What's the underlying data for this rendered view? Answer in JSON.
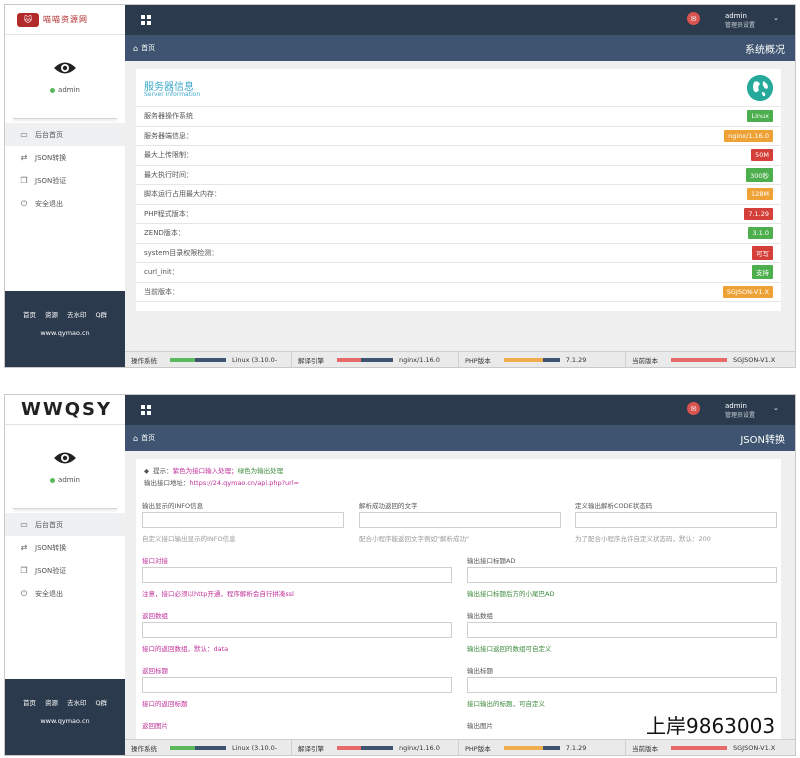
{
  "screen1": {
    "logo_text": "喵喵资源网",
    "user": "admin",
    "menu": [
      "后台首页",
      "JSON转换",
      "JSON验证",
      "安全退出"
    ],
    "footer_links": [
      "首页",
      "资源",
      "去水印",
      "Q群"
    ],
    "footer_domain": "www.qymao.cn",
    "top_admin": "admin",
    "top_role": "管理员设置",
    "breadcrumb": "首页",
    "page_title": "系统概况",
    "card_title": "服务器信息",
    "card_subtitle": "Server information",
    "info_rows": [
      {
        "label": "服务器操作系统",
        "value": "Linux"
      },
      {
        "label": "服务器端信息：",
        "value": "nginx/1.16.0"
      },
      {
        "label": "最大上传限制：",
        "value": "50M"
      },
      {
        "label": "最大执行时间：",
        "value": "300秒"
      },
      {
        "label": "脚本运行占用最大内存：",
        "value": "128M"
      },
      {
        "label": "PHP程式版本：",
        "value": "7.1.29"
      },
      {
        "label": "ZEND版本：",
        "value": "3.1.0"
      },
      {
        "label": "system目录权限检测：",
        "value": "可写"
      },
      {
        "label": "curl_init：",
        "value": "支持"
      },
      {
        "label": "当前版本：",
        "value": "SGJSON-V1.X"
      }
    ]
  },
  "status": [
    {
      "label": "操作系统",
      "value": "Linux (3.10.0-"
    },
    {
      "label": "解译引擎",
      "value": "nginx/1.16.0"
    },
    {
      "label": "PHP版本",
      "value": "7.1.29"
    },
    {
      "label": "当前版本",
      "value": "SGJSON-V1.X"
    }
  ],
  "screen2": {
    "logo_text": "WWQSY",
    "user": "admin",
    "menu": [
      "后台首页",
      "JSON转换",
      "JSON验证",
      "安全退出"
    ],
    "footer_links": [
      "首页",
      "资源",
      "去水印",
      "Q群"
    ],
    "footer_domain": "www.qymao.cn",
    "top_admin": "admin",
    "top_role": "管理员设置",
    "breadcrumb": "首页",
    "page_title": "JSON转换",
    "hint_prefix": "提示：",
    "hint_pink": "紫色为接口输入处理；",
    "hint_green": "绿色为输出处理",
    "api_prefix": "输出接口地址：",
    "api_url": "https://24.qymao.cn/api.php?url=",
    "fields": {
      "info_label": "输出显示的INFO信息",
      "info_help": "自定义接口输出显示的INFO信息",
      "parse_label": "解析成功返回的文字",
      "parse_help": "配合小程序能返回文字例如\"解析成功\"",
      "code_label": "定义输出解析CODE状态码",
      "code_help": "为了配合小程序允许自定义状态码，默认：200",
      "docking_label": "接口对接",
      "docking_help": "注意，接口必须以http开通，程序解析会自行拼凑ssl",
      "title_ad_label": "输出接口标题AD",
      "title_ad_help": "输出接口标题后方的小尾巴AD",
      "return_data_label": "返回数组",
      "return_data_help": "接口的返回数组，默认：data",
      "out_data_label": "输出数组",
      "out_data_help": "输出接口返回的数组可自定义",
      "return_title_label": "返回标题",
      "return_title_help": "接口的返回标题",
      "out_title_label": "输出标题",
      "out_title_help": "接口输出的标题，可自定义",
      "return_image_label": "返回图片",
      "out_image_label": "输出图片"
    }
  },
  "watermark": "上岸9863003",
  "colors": {
    "sidebar_footer": "#2b3a4c",
    "topbar": "#2b3a4c",
    "breadcrumb": "#3e5470",
    "accent_red": "#d9534f",
    "badge_green": "#4cae4c",
    "badge_orange": "#eea236",
    "badge_red": "#d43f3a",
    "title_blue": "#3aa7c9"
  }
}
